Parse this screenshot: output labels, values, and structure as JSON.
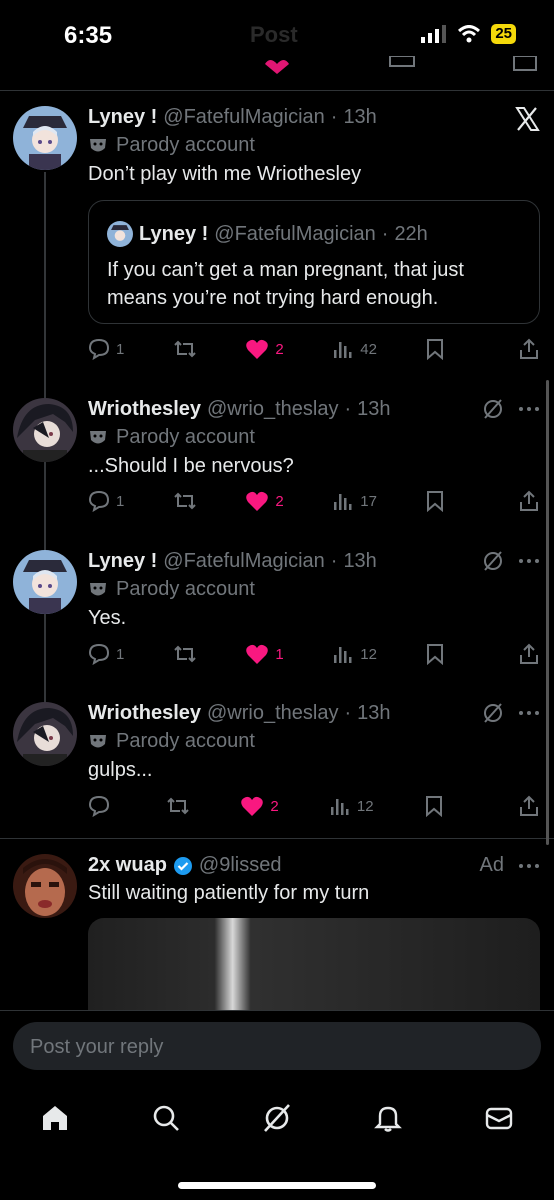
{
  "status_bar": {
    "time": "6:35",
    "battery": "25"
  },
  "header": {
    "title": "Post"
  },
  "tweets": [
    {
      "name": "Lyney !",
      "handle": "@FatefulMagician",
      "time": "13h",
      "parody": "Parody account",
      "text": "Don’t play with me Wriothesley",
      "quote": {
        "name": "Lyney !",
        "handle": "@FatefulMagician",
        "time": "22h",
        "text": "If you can’t get a man pregnant, that just means you’re not trying hard enough."
      },
      "replies": "1",
      "likes": "2",
      "views": "42"
    },
    {
      "name": "Wriothesley",
      "handle": "@wrio_theslay",
      "time": "13h",
      "parody": "Parody account",
      "text": "...Should I be nervous?",
      "replies": "1",
      "likes": "2",
      "views": "17"
    },
    {
      "name": "Lyney !",
      "handle": "@FatefulMagician",
      "time": "13h",
      "parody": "Parody account",
      "text": "Yes.",
      "replies": "1",
      "likes": "1",
      "views": "12"
    },
    {
      "name": "Wriothesley",
      "handle": "@wrio_theslay",
      "time": "13h",
      "parody": "Parody account",
      "text": "gulps...",
      "replies": "",
      "likes": "2",
      "views": "12"
    }
  ],
  "ad": {
    "name": "2x wuap",
    "handle": "@9lissed",
    "label": "Ad",
    "text": "Still waiting patiently for my turn"
  },
  "reply": {
    "placeholder": "Post your reply"
  },
  "colors": {
    "like": "#f91880",
    "verified": "#1d9bf0",
    "muted": "#71767b"
  },
  "icons": {
    "x_logo": "x-logo-icon",
    "grok": "grok-icon",
    "more": "more-icon"
  }
}
